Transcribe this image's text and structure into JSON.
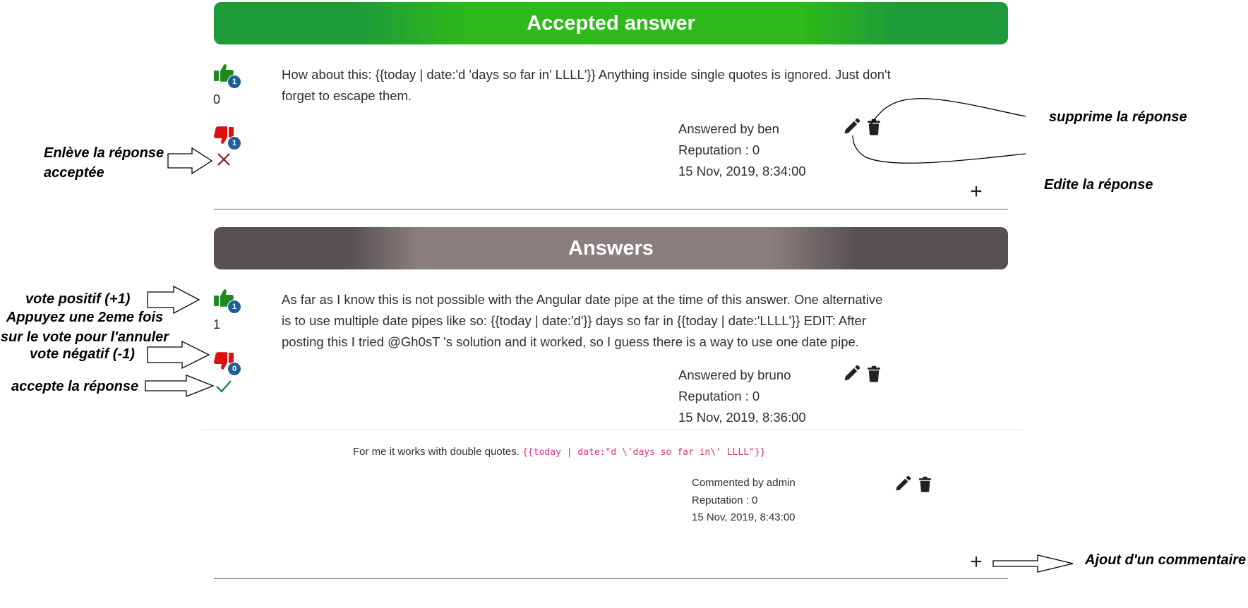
{
  "accepted": {
    "banner": "Accepted answer",
    "upvote_badge": "1",
    "score": "0",
    "downvote_badge": "1",
    "text_line1": "How about this: {{today | date:'d 'days so far in' LLLL'}} Anything inside single quotes is ignored. Just don't",
    "text_line2": "forget to escape them.",
    "author": "Answered by ben",
    "reputation": "Reputation : 0",
    "date": "15 Nov, 2019, 8:34:00"
  },
  "answers": {
    "banner": "Answers",
    "upvote_badge": "1",
    "score": "1",
    "downvote_badge": "0",
    "text_line1": "As far as I know this is not possible with the Angular date pipe at the time of this answer. One alternative",
    "text_line2": "is to use multiple date pipes like so: {{today | date:'d'}} days so far in {{today | date:'LLLL'}} EDIT: After",
    "text_line3": "posting this I tried @Gh0sT 's solution and it worked, so I guess there is a way to use one date pipe.",
    "author": "Answered by bruno",
    "reputation": "Reputation : 0",
    "date": "15 Nov, 2019, 8:36:00"
  },
  "comment": {
    "text": "For me it works with double quotes.",
    "code": "{{today | date:\"d \\'days so far in\\' LLLL\"}}",
    "author": "Commented by admin",
    "reputation": "Reputation : 0",
    "date": "15 Nov, 2019, 8:43:00"
  },
  "annotations": {
    "delete": "supprime la réponse",
    "edit": "Edite la réponse",
    "unaccept_line1": "Enlève la réponse",
    "unaccept_line2": "acceptée",
    "upvote": "vote positif (+1)",
    "cancel_line1": "Appuyez une 2eme fois",
    "cancel_line2": "sur le vote pour l'annuler",
    "downvote": "vote négatif (-1)",
    "accept": "accepte la réponse",
    "add_comment": "Ajout d'un commentaire"
  },
  "colors": {
    "accepted_green": "#2dba1a",
    "answers_gray": "#8a7f7e",
    "thumb_up": "#1e8a1e",
    "thumb_down": "#e01010",
    "badge_blue": "#1f5f99",
    "unaccept_red": "#8b1a1a",
    "accept_green": "#1a8a3a",
    "code_pink": "#d63384"
  },
  "icons": [
    "thumbs-up-icon",
    "thumbs-down-icon",
    "close-icon",
    "check-icon",
    "pencil-icon",
    "trash-icon",
    "plus-icon"
  ]
}
